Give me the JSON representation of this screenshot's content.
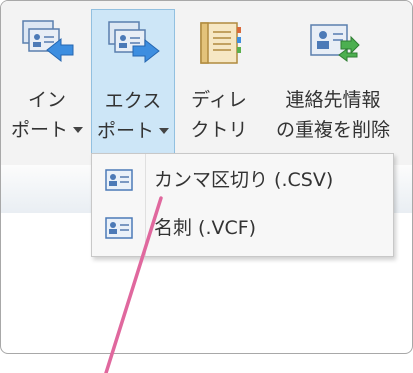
{
  "ribbon": {
    "import": {
      "line1": "イン",
      "line2": "ポート"
    },
    "export": {
      "line1": "エクス",
      "line2": "ポート"
    },
    "directory": {
      "line1": "ディレ",
      "line2": "クトリ"
    },
    "dedupe": {
      "line1": "連絡先情報",
      "line2": "の重複を削除"
    }
  },
  "menu": {
    "items": [
      {
        "label": "カンマ区切り (.CSV)",
        "icon": "contact-card-icon"
      },
      {
        "label": "名刺 (.VCF)",
        "icon": "contact-card-icon"
      }
    ]
  },
  "colors": {
    "active_bg": "#cde6f7",
    "active_border": "#92c0e0",
    "pointer": "#e0689e"
  }
}
